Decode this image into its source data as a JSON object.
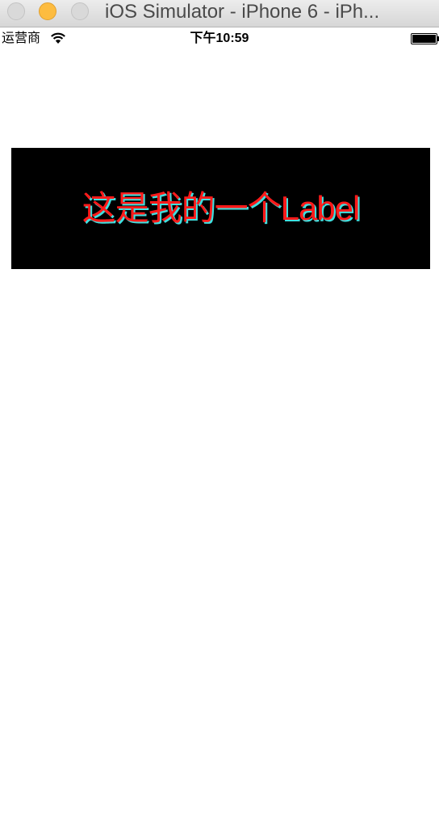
{
  "window": {
    "title": "iOS Simulator - iPhone 6 - iPh..."
  },
  "status_bar": {
    "carrier": "运营商",
    "time": "下午10:59"
  },
  "label": {
    "text": "这是我的一个Label",
    "text_color": "#ff1a1a",
    "shadow_color": "#3fe0e0",
    "background_color": "#000000"
  }
}
